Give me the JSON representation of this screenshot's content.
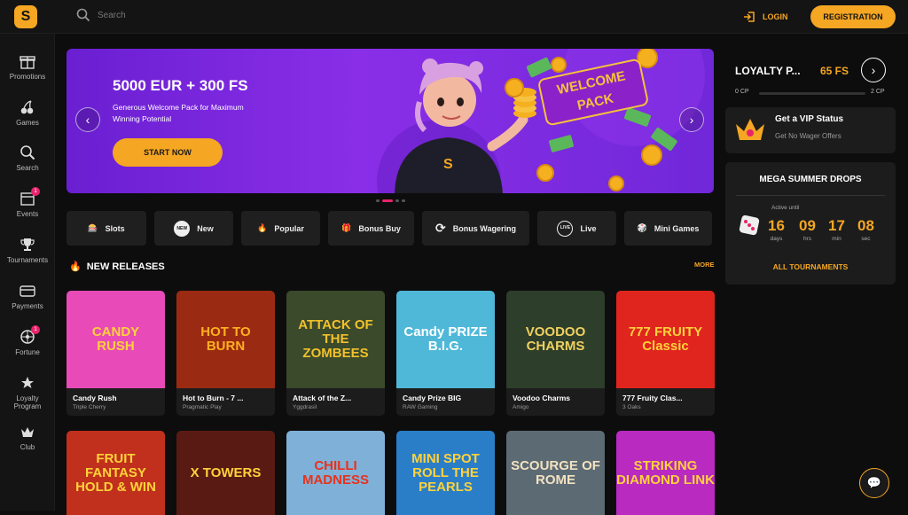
{
  "header": {
    "search_placeholder": "Search",
    "login": "LOGIN",
    "registration": "REGISTRATION"
  },
  "sidebar": {
    "items": [
      {
        "label": "Promotions",
        "icon": "gift-icon"
      },
      {
        "label": "Games",
        "icon": "cherry-icon"
      },
      {
        "label": "Search",
        "icon": "search-icon"
      },
      {
        "label": "Events",
        "icon": "calendar-icon",
        "badge": "1"
      },
      {
        "label": "Tournaments",
        "icon": "trophy-icon"
      },
      {
        "label": "Payments",
        "icon": "card-icon"
      },
      {
        "label": "Fortune",
        "icon": "wheel-icon",
        "badge": "1"
      },
      {
        "label": "Loyalty Program",
        "icon": "loyalty-icon"
      },
      {
        "label": "Club",
        "icon": "crown-icon"
      }
    ]
  },
  "hero": {
    "title": "5000 EUR + 300 FS",
    "subtitle": "Generous Welcome Pack for Maximum Winning Potential",
    "cta": "START NOW",
    "badge_line1": "WELCOME",
    "badge_line2": "PACK",
    "mascot_letter": "S"
  },
  "categories": [
    {
      "label": "Slots",
      "icon": "slots-icon"
    },
    {
      "label": "New",
      "icon": "new-icon"
    },
    {
      "label": "Popular",
      "icon": "fire-icon"
    },
    {
      "label": "Bonus Buy",
      "icon": "gift-icon"
    },
    {
      "label": "Bonus Wagering",
      "icon": "dollar-cycle-icon"
    },
    {
      "label": "Live",
      "icon": "live-icon"
    },
    {
      "label": "Mini Games",
      "icon": "dice-icon"
    }
  ],
  "section": {
    "title": "NEW RELEASES",
    "more": "MORE"
  },
  "games_row1": [
    {
      "name": "Candy Rush",
      "provider": "Triple Cherry",
      "art": "CANDY RUSH",
      "bg": "#e84ab8",
      "fg": "#ffd23a"
    },
    {
      "name": "Hot to Burn - 7 ...",
      "provider": "Pragmatic Play",
      "art": "HOT TO BURN",
      "bg": "#9b2a12",
      "fg": "#ffb020"
    },
    {
      "name": "Attack of the Z...",
      "provider": "Yggdrasil",
      "art": "ATTACK OF THE ZOMBEES",
      "bg": "#3b4a2a",
      "fg": "#f2c12a"
    },
    {
      "name": "Candy Prize BIG",
      "provider": "RAW Gaming",
      "art": "Candy PRIZE B.I.G.",
      "bg": "#4fb8d8",
      "fg": "#ffffff"
    },
    {
      "name": "Voodoo Charms",
      "provider": "Amigo",
      "art": "VOODOO CHARMS",
      "bg": "#2d3e2a",
      "fg": "#f0d060"
    },
    {
      "name": "777 Fruity Clas...",
      "provider": "3 Oaks",
      "art": "777 FRUITY Classic",
      "bg": "#e0251e",
      "fg": "#ffd23a"
    }
  ],
  "games_row2": [
    {
      "art": "FRUIT FANTASY HOLD & WIN",
      "bg": "#c0301c",
      "fg": "#ffd23a"
    },
    {
      "art": "X TOWERS",
      "bg": "#5a1a14",
      "fg": "#ffd23a"
    },
    {
      "art": "CHILLI MADNESS",
      "bg": "#7fb0d8",
      "fg": "#e8321c"
    },
    {
      "art": "MINI SPOT ROLL THE PEARLS",
      "bg": "#2a7ec8",
      "fg": "#ffd23a"
    },
    {
      "art": "SCOURGE OF ROME",
      "bg": "#5c6a74",
      "fg": "#f2e2c0"
    },
    {
      "art": "STRIKING DIAMOND LINK",
      "bg": "#b82ac0",
      "fg": "#ffd23a"
    }
  ],
  "loyalty": {
    "title": "LOYALTY P...",
    "fs": "65 FS",
    "cp_start": "0 CP",
    "cp_end": "2 CP",
    "progress": 0
  },
  "vip": {
    "title": "Get a VIP Status",
    "subtitle": "Get No Wager Offers"
  },
  "drops": {
    "title": "MEGA SUMMER DROPS",
    "active_until": "Active until",
    "countdown": [
      {
        "value": "16",
        "unit": "days"
      },
      {
        "value": "09",
        "unit": "hrs"
      },
      {
        "value": "17",
        "unit": "min"
      },
      {
        "value": "08",
        "unit": "sec"
      }
    ],
    "all": "ALL TOURNAMENTS"
  },
  "colors": {
    "accent": "#f5a623",
    "badge": "#e8236b",
    "hero": "#7a26dc"
  }
}
